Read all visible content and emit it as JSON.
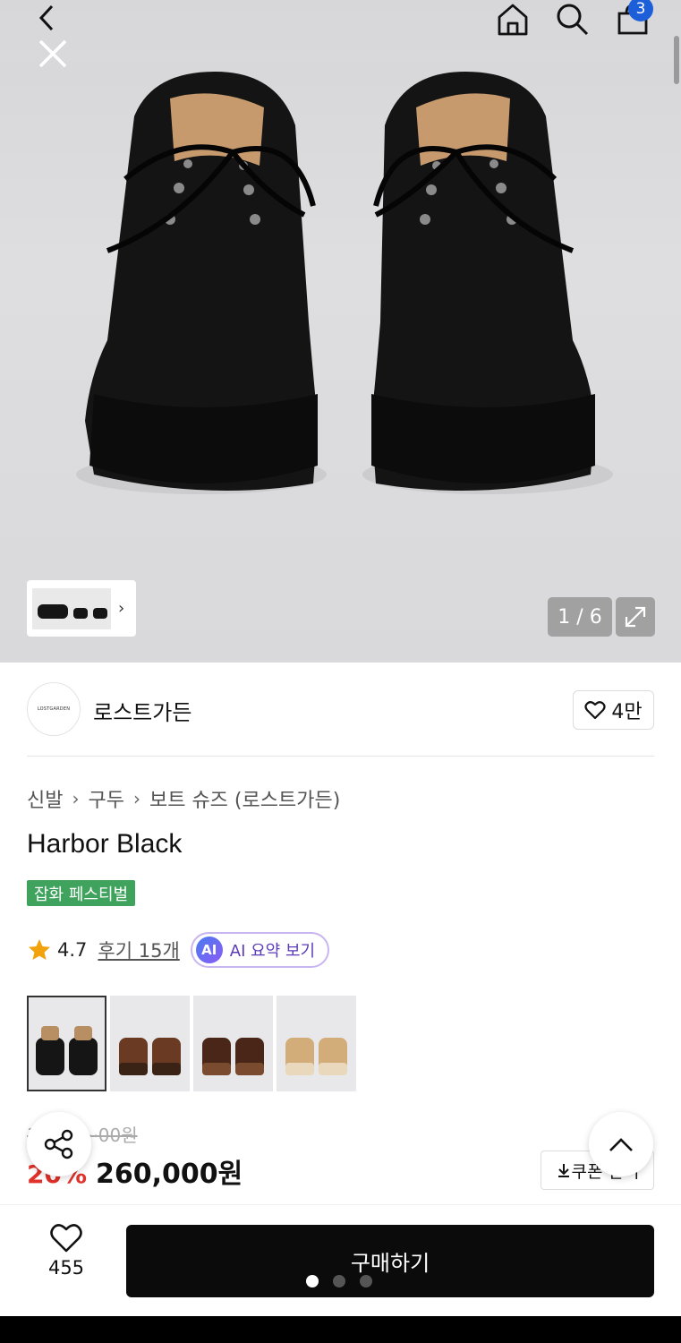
{
  "header": {
    "cart_count": "3"
  },
  "gallery": {
    "counter": "1 / 6",
    "thumb_chevron": "›"
  },
  "brand": {
    "logo_text": "LOSTGARDEN",
    "name": "로스트가든",
    "like_count": "4만"
  },
  "breadcrumb": {
    "items": [
      "신발",
      "구두",
      "보트 슈즈 (로스트가든)"
    ],
    "separator": "›"
  },
  "product": {
    "title": "Harbor Black",
    "badge": "잡화 페스티벌",
    "rating": "4.7",
    "review_label": "후기 15개",
    "ai_label": "AI 요약 보기",
    "ai_icon_text": "AI",
    "original_price": "3~~~~00원",
    "discount": "20%",
    "price": "260,000원",
    "coupon_label": "쿠폰 받기"
  },
  "variants": [
    "black",
    "brown",
    "dark-brown",
    "tan"
  ],
  "bottom_bar": {
    "wish_count": "455",
    "buy_label": "구매하기"
  },
  "colors": {
    "accent_blue": "#1d5fd9",
    "badge_green": "#3fa35d",
    "discount_red": "#e0312a",
    "ai_purple": "#5b3bb8"
  }
}
